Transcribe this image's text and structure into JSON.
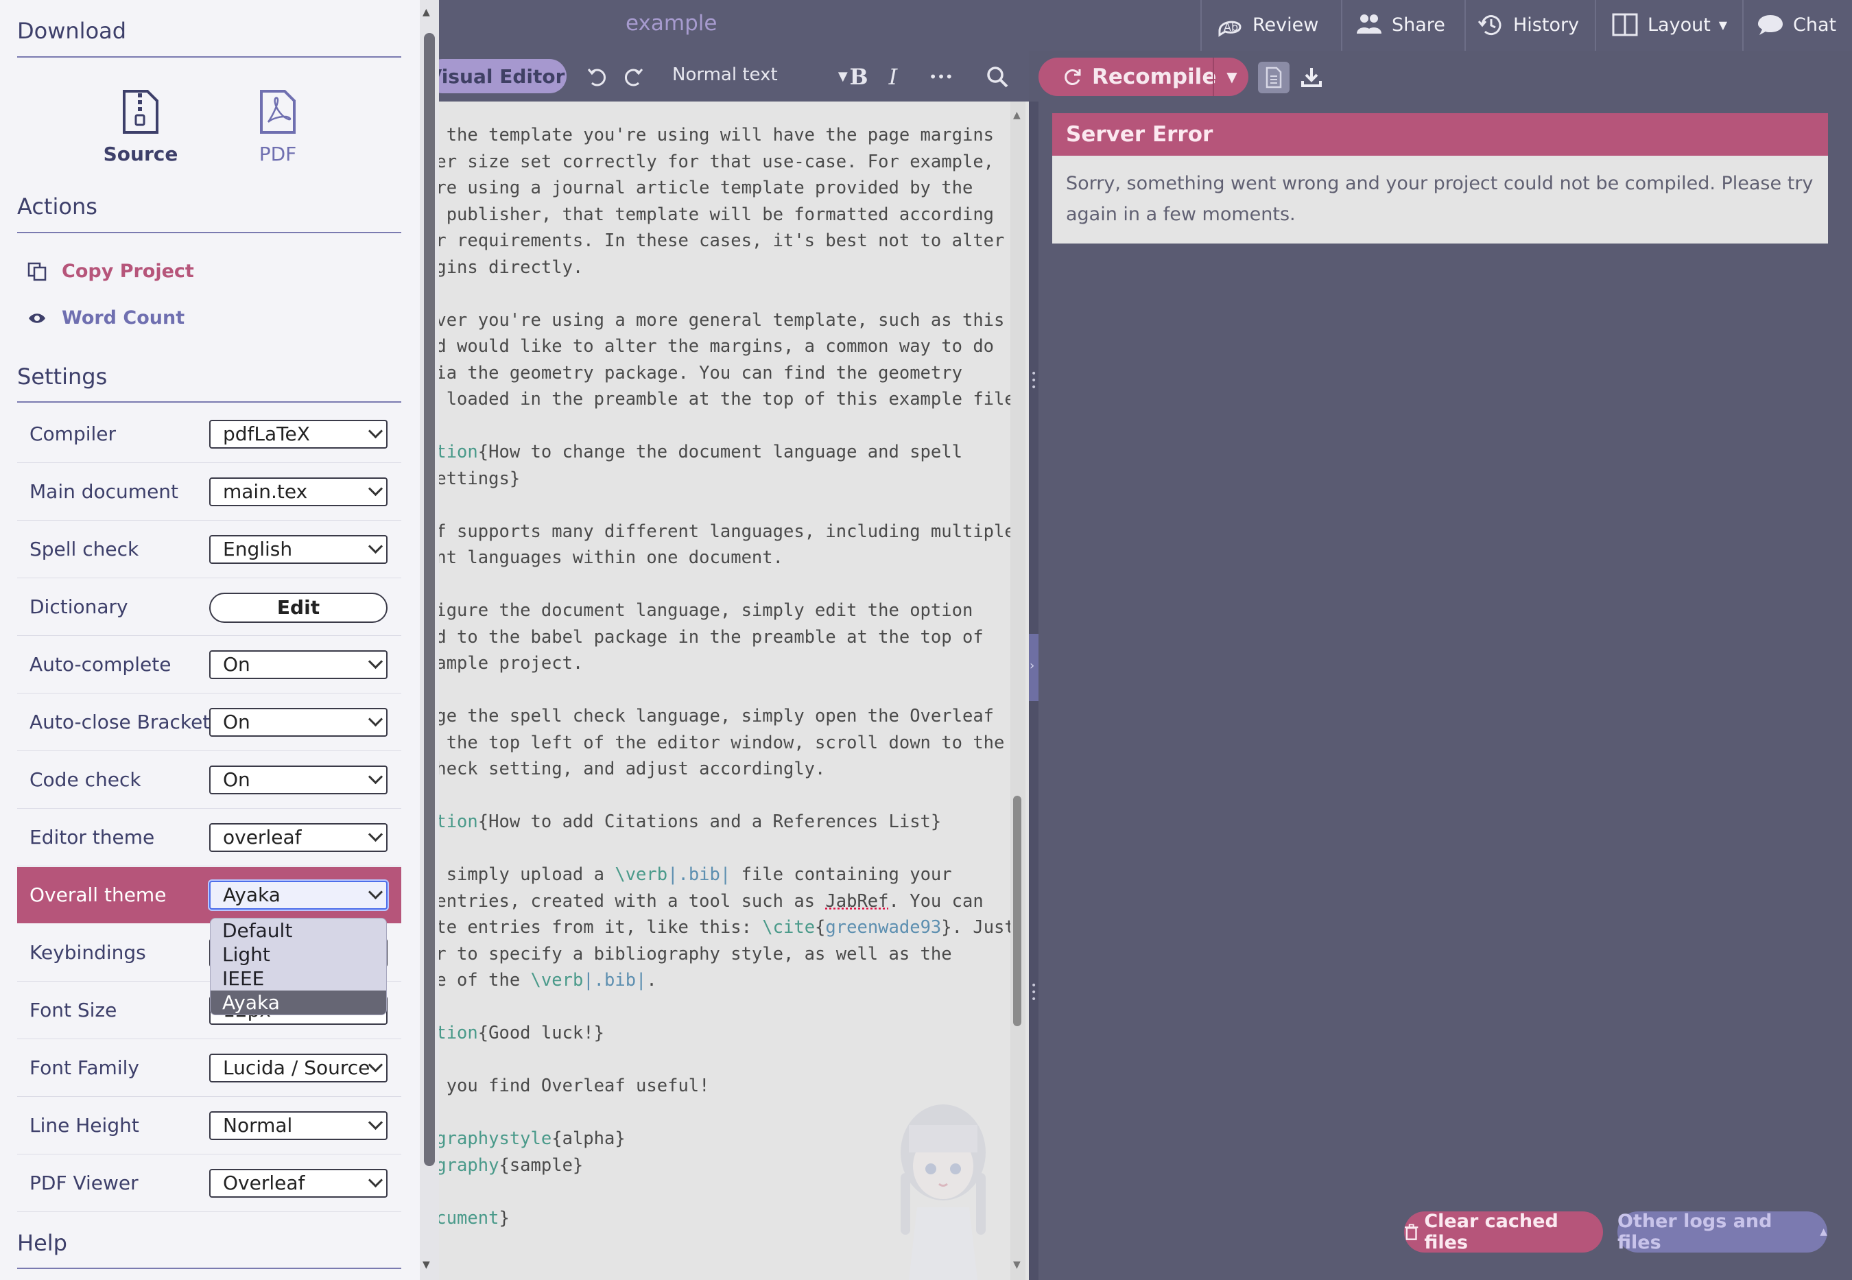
{
  "header": {
    "project_title": "example",
    "review": "Review",
    "share": "Share",
    "history": "History",
    "layout": "Layout",
    "chat": "Chat"
  },
  "editor": {
    "visual_editor": "Visual Editor",
    "text_style": "Normal text",
    "bold": "B",
    "italic": "I",
    "more": "•••"
  },
  "pdf": {
    "recompile": "Recompile",
    "error_title": "Server Error",
    "error_message": "Sorry, something went wrong and your project could not be compiled. Please try again in a few moments.",
    "clear_cache": "Clear cached files",
    "other_logs": "Other logs and files"
  },
  "menu": {
    "download_heading": "Download",
    "source": "Source",
    "pdf": "PDF",
    "actions_heading": "Actions",
    "copy_project": "Copy Project",
    "word_count": "Word Count",
    "settings_heading": "Settings",
    "help_heading": "Help",
    "settings": {
      "compiler": {
        "label": "Compiler",
        "value": "pdfLaTeX"
      },
      "main_document": {
        "label": "Main document",
        "value": "main.tex"
      },
      "spell_check": {
        "label": "Spell check",
        "value": "English"
      },
      "dictionary": {
        "label": "Dictionary",
        "value": "Edit"
      },
      "auto_complete": {
        "label": "Auto-complete",
        "value": "On"
      },
      "auto_close": {
        "label": "Auto-close Brackets",
        "value": "On"
      },
      "code_check": {
        "label": "Code check",
        "value": "On"
      },
      "editor_theme": {
        "label": "Editor theme",
        "value": "overleaf"
      },
      "overall_theme": {
        "label": "Overall theme",
        "value": "Ayaka"
      },
      "keybindings": {
        "label": "Keybindings",
        "value": ""
      },
      "font_size": {
        "label": "Font Size",
        "value": "12px"
      },
      "font_family": {
        "label": "Font Family",
        "value": "Lucida / Source"
      },
      "line_height": {
        "label": "Line Height",
        "value": "Normal"
      },
      "pdf_viewer": {
        "label": "PDF Viewer",
        "value": "Overleaf"
      }
    },
    "theme_options": [
      "Default",
      "Light",
      "IEEE",
      "Ayaka"
    ]
  },
  "code_lines": [
    "y the template you're using will have the page margins",
    "per size set correctly for that use-case. For example,",
    "'re using a journal article template provided by the",
    "l publisher, that template will be formatted according",
    "ir requirements. In these cases, it's best not to alter",
    "rgins directly.",
    "",
    "ever you're using a more general template, such as this",
    "nd would like to alter the margins, a common way to do",
    "via the geometry package. You can find the geometry",
    "e loaded in the preamble at the top of this example file.",
    "",
    "ction{How to change the document language and spell",
    "settings}",
    "",
    "af supports many different languages, including multiple",
    "ent languages within one document.",
    "",
    "figure the document language, simply edit the option",
    "ed to the babel package in the preamble at the top of",
    "xample project.",
    "",
    "nge the spell check language, simply open the Overleaf",
    "t the top left of the editor window, scroll down to the",
    "check setting, and adjust accordingly.",
    "",
    "ction{How to add Citations and a References List}",
    "",
    "n simply upload a \\verb|.bib| file containing your",
    " entries, created with a tool such as JabRef. You can",
    "ite entries from it, like this: \\cite{greenwade93}. Just",
    "er to specify a bibliography style, as well as the",
    "me of the \\verb|.bib|.",
    "",
    "ction{Good luck!}",
    "",
    "e you find Overleaf useful!",
    "",
    "ographystyle{alpha}",
    "ography{sample}",
    "",
    "ocument}"
  ],
  "colors": {
    "accent": "#b6557a",
    "topbar": "#5b5c74",
    "pane_bg": "#5a5b72",
    "menu_bg": "#f4f4f8",
    "link_purple": "#7a7ab0"
  },
  "icons": [
    "review-icon",
    "share-icon",
    "history-icon",
    "layout-icon",
    "chat-icon",
    "undo-icon",
    "redo-icon",
    "search-icon",
    "refresh-icon",
    "document-icon",
    "download-icon",
    "zip-icon",
    "pdf-icon",
    "copy-icon",
    "eye-icon",
    "trash-icon"
  ]
}
